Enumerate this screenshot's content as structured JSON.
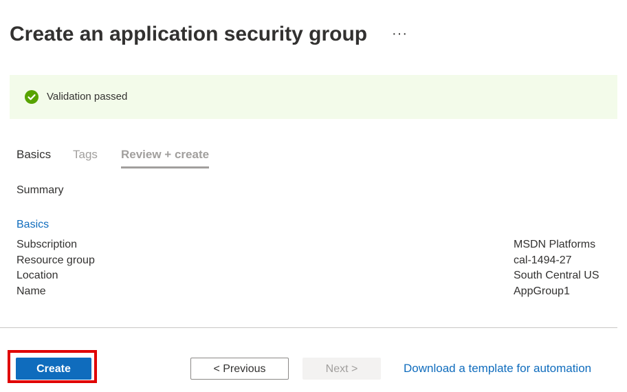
{
  "header": {
    "title": "Create an application security group",
    "more_label": "···"
  },
  "validation": {
    "status_text": "Validation passed",
    "icon": "check-circle-icon",
    "status_color": "#57a300"
  },
  "tabs": [
    {
      "label": "Basics",
      "state": "default"
    },
    {
      "label": "Tags",
      "state": "disabled"
    },
    {
      "label": "Review + create",
      "state": "selected"
    }
  ],
  "summary": {
    "heading": "Summary",
    "section_title": "Basics",
    "rows": [
      {
        "label": "Subscription",
        "value": "MSDN Platforms"
      },
      {
        "label": "Resource group",
        "value": "cal-1494-27"
      },
      {
        "label": "Location",
        "value": "South Central US"
      },
      {
        "label": "Name",
        "value": "AppGroup1"
      }
    ]
  },
  "footer": {
    "create_label": "Create",
    "previous_label": "< Previous",
    "next_label": "Next >",
    "download_link": "Download a template for automation"
  },
  "colors": {
    "accent": "#0f6cbd",
    "banner_bg": "#f3fbea",
    "highlight": "#e00000"
  }
}
